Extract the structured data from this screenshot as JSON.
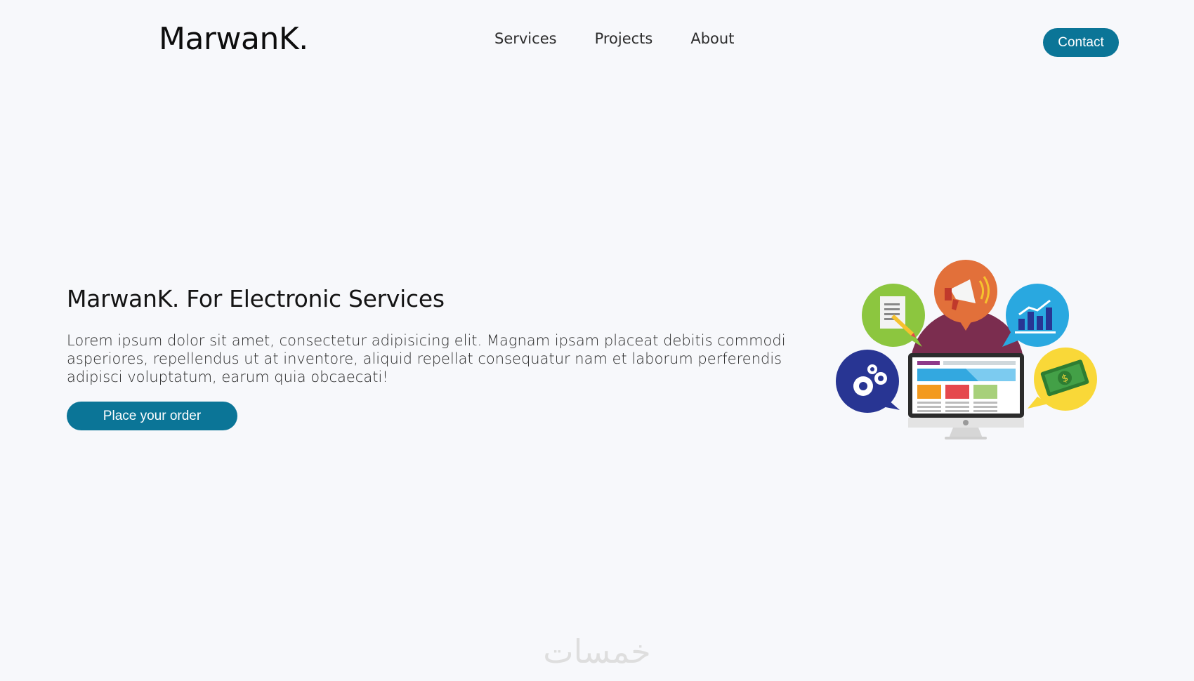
{
  "header": {
    "logo": "MarwanK.",
    "nav": [
      {
        "label": "Services"
      },
      {
        "label": "Projects"
      },
      {
        "label": "About"
      }
    ],
    "contact_label": "Contact"
  },
  "hero": {
    "title": "MarwanK. For Electronic Services",
    "text": "Lorem ipsum dolor sit amet, consectetur adipisicing elit. Magnam ipsam placeat debitis commodi asperiores, repellendus ut at inventore, aliquid repellat consequatur nam et laborum perferendis adipisci voluptatum, earum quia obcaecati!",
    "cta_label": "Place your order"
  },
  "watermark": "خمسات",
  "colors": {
    "accent": "#0b7597",
    "background": "#f7f8fb"
  },
  "illustration_icons": [
    "document-icon",
    "megaphone-icon",
    "chart-icon",
    "gears-icon",
    "money-icon",
    "monitor-icon"
  ]
}
